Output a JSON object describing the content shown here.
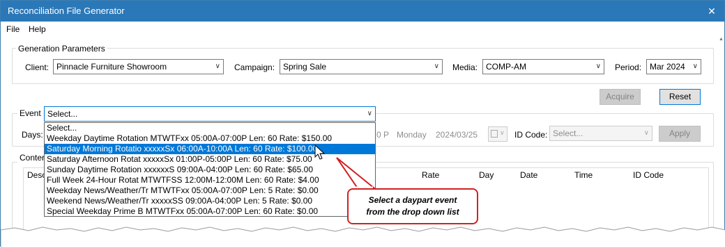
{
  "window": {
    "title": "Reconciliation File Generator",
    "close_glyph": "✕"
  },
  "menu": {
    "file": "File",
    "help": "Help"
  },
  "generation": {
    "legend": "Generation Parameters",
    "client_label": "Client:",
    "client_value": "Pinnacle Furniture Showroom",
    "campaign_label": "Campaign:",
    "campaign_value": "Spring Sale",
    "media_label": "Media:",
    "media_value": "COMP-AM",
    "period_label": "Period:",
    "period_value": "Mar 2024",
    "acquire": "Acquire",
    "reset": "Reset"
  },
  "event": {
    "label": "Event",
    "value": "Select...",
    "options": [
      "Select...",
      "Weekday Daytime Rotation  MTWTFxx  05:00A-07:00P  Len: 60  Rate: $150.00",
      "Saturday Morning Rotatio  xxxxxSx  06:00A-10:00A  Len: 60  Rate: $100.00",
      "Saturday Afternoon Rotat  xxxxxSx  01:00P-05:00P  Len: 60  Rate: $75.00",
      "Sunday Daytime Rotation  xxxxxxS  09:00A-04:00P  Len: 60  Rate: $65.00",
      "Full Week 24-Hour Rotat  MTWTFSS  12:00M-12:00M  Len: 60  Rate: $4.00",
      "Weekday News/Weather/Tr  MTWTFxx  05:00A-07:00P  Len: 5  Rate: $0.00",
      "Weekend News/Weather/Tr  xxxxxSS  09:00A-04:00P  Len: 5  Rate: $0.00",
      "Special Weekday Prime B  MTWTFxx  05:00A-07:00P  Len: 60  Rate: $0.00"
    ],
    "selected_index": 2
  },
  "days": {
    "label": "Days:",
    "time_fragment": "0 P",
    "day_name": "Monday",
    "date": "2024/03/25",
    "id_code_label": "ID Code:",
    "id_code_value": "Select...",
    "apply": "Apply"
  },
  "content": {
    "legend_fragment": "Conter",
    "desc_fragment": "Desc",
    "columns": [
      "Rate",
      "Day",
      "Date",
      "Time",
      "ID Code"
    ]
  },
  "callout": {
    "line1": "Select a daypart event",
    "line2": "from the drop down list"
  },
  "colors": {
    "titlebar": "#2b78b8",
    "selection": "#0078d7",
    "callout_border": "#d32020"
  }
}
